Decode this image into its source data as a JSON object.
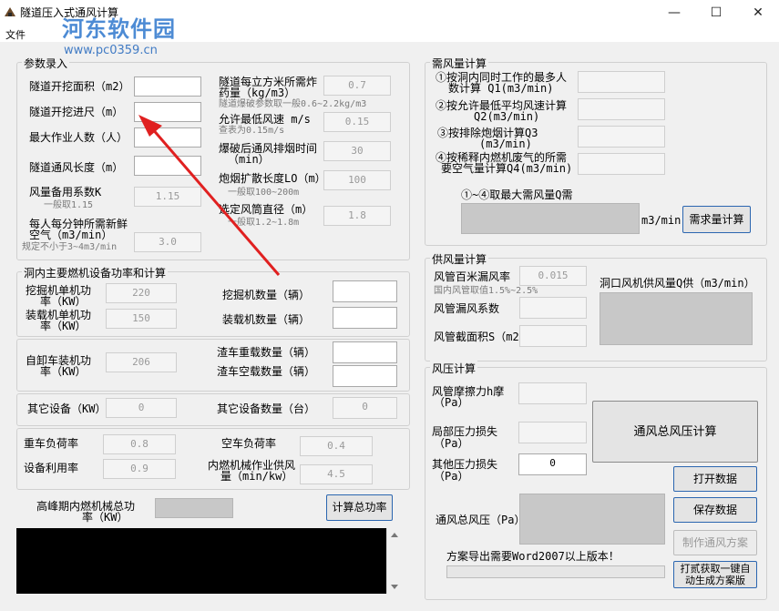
{
  "window": {
    "title": "隧道压入式通风计算",
    "menu_file": "文件",
    "minimize": "—",
    "maximize": "☐",
    "close": "✕"
  },
  "watermark": {
    "line1": "河东软件园",
    "line2": "www.pc0359.cn"
  },
  "params": {
    "title": "参数录入",
    "area_label": "隧道开挖面积（m2）",
    "area_value": "",
    "advance_label": "隧道开挖进尺（m）",
    "advance_value": "",
    "workers_label": "最大作业人数（人）",
    "workers_value": "",
    "length_label": "隧道通风长度（m）",
    "length_value": "",
    "spare_label": "风量备用系数K",
    "spare_note": "一般取1.15",
    "spare_value": "1.15",
    "fresh_label_1": "每人每分钟所需新鲜",
    "fresh_label_2": "空气（m3/min）",
    "fresh_note": "规定不小于3~4m3/min",
    "fresh_value": "3.0",
    "explosive_label_1": "隧道每立方米所需炸",
    "explosive_label_2": "药量（kg/m3）",
    "explosive_note": "隧道爆破参数取一般0.6~2.2kg/m3",
    "explosive_value": "0.7",
    "minwind_label": "允许最低风速 m/s",
    "minwind_note": "查表为0.15m/s",
    "minwind_value": "0.15",
    "smoke_time_label_1": "爆破后通风排烟时间",
    "smoke_time_label_2": "（min）",
    "smoke_time_value": "30",
    "smoke_len_label": "炮烟扩散长度LO（m）",
    "smoke_len_note": "一般取100~200m",
    "smoke_len_value": "100",
    "duct_label": "选定风筒直径（m）",
    "duct_note": "一般取1.2~1.8m",
    "duct_value": "1.8"
  },
  "equip": {
    "title": "洞内主要燃机设备功率和计算",
    "excavator_power_label_1": "挖掘机单机功",
    "excavator_power_label_2": "率（KW）",
    "excavator_power_value": "220",
    "excavator_count_label": "挖掘机数量（辆）",
    "excavator_count_value": "",
    "loader_power_label_1": "装载机单机功",
    "loader_power_label_2": "率（KW）",
    "loader_power_value": "150",
    "loader_count_label": "装载机数量（辆）",
    "loader_count_value": "",
    "dumper_power_label_1": "自卸车装机功",
    "dumper_power_label_2": "率（KW）",
    "dumper_power_value": "206",
    "truck_loaded_label": "渣车重载数量（辆）",
    "truck_loaded_value": "",
    "truck_empty_label": "渣车空载数量（辆）",
    "truck_empty_value": "",
    "other_power_label": "其它设备（KW）",
    "other_power_value": "0",
    "other_count_label": "其它设备数量（台）",
    "other_count_value": "0",
    "heavy_load_label": "重车负荷率",
    "heavy_load_value": "0.8",
    "empty_load_label": "空车负荷率",
    "empty_load_value": "0.4",
    "utilization_label": "设备利用率",
    "utilization_value": "0.9",
    "supply_label_1": "内燃机械作业供风",
    "supply_label_2": "量（min/kw）",
    "supply_value": "4.5",
    "peak_label_1": "高峰期内燃机械总功",
    "peak_label_2": "率（KW）",
    "calc_power_button": "计算总功率"
  },
  "demand": {
    "title": "需风量计算",
    "q1_label_1": "①按洞内同时工作的最多人",
    "q1_label_2": "数计算 Q1(m3/min)",
    "q2_label_1": "②按允许最低平均风速计算",
    "q2_label_2": "Q2(m3/min)",
    "q3_label_1": "③按排除炮烟计算Q3",
    "q3_label_2": "(m3/min)",
    "q4_label_1": "④按稀释内燃机废气的所需",
    "q4_label_2": "要空气量计算Q4(m3/min)",
    "max_label": "①~④取最大需风量Q需",
    "unit": "m3/min",
    "button": "需求量计算"
  },
  "supply": {
    "title": "供风量计算",
    "leak_rate_label": "风管百米漏风率",
    "leak_rate_note": "国内风管取值1.5%~2.5%",
    "leak_rate_value": "0.015",
    "leak_coef_label": "风管漏风系数",
    "area_label": "风管截面积S（m2）",
    "fan_label": "洞口风机供风量Q供（m3/min）"
  },
  "pressure": {
    "title": "风压计算",
    "friction_label_1": "风管摩擦力h摩",
    "friction_label_2": "（Pa）",
    "local_label_1": "局部压力损失",
    "local_label_2": "（Pa）",
    "other_label_1": "其他压力损失",
    "other_label_2": "（Pa）",
    "other_value": "0",
    "total_label": "通风总风压（Pa）",
    "calc_button": "通风总风压计算",
    "open_button": "打开数据",
    "save_button": "保存数据",
    "make_button": "制作通风方案",
    "export_note": "方案导出需要Word2007以上版本！",
    "auto_button_1": "打贰获取一键自",
    "auto_button_2": "动生成方案版"
  }
}
